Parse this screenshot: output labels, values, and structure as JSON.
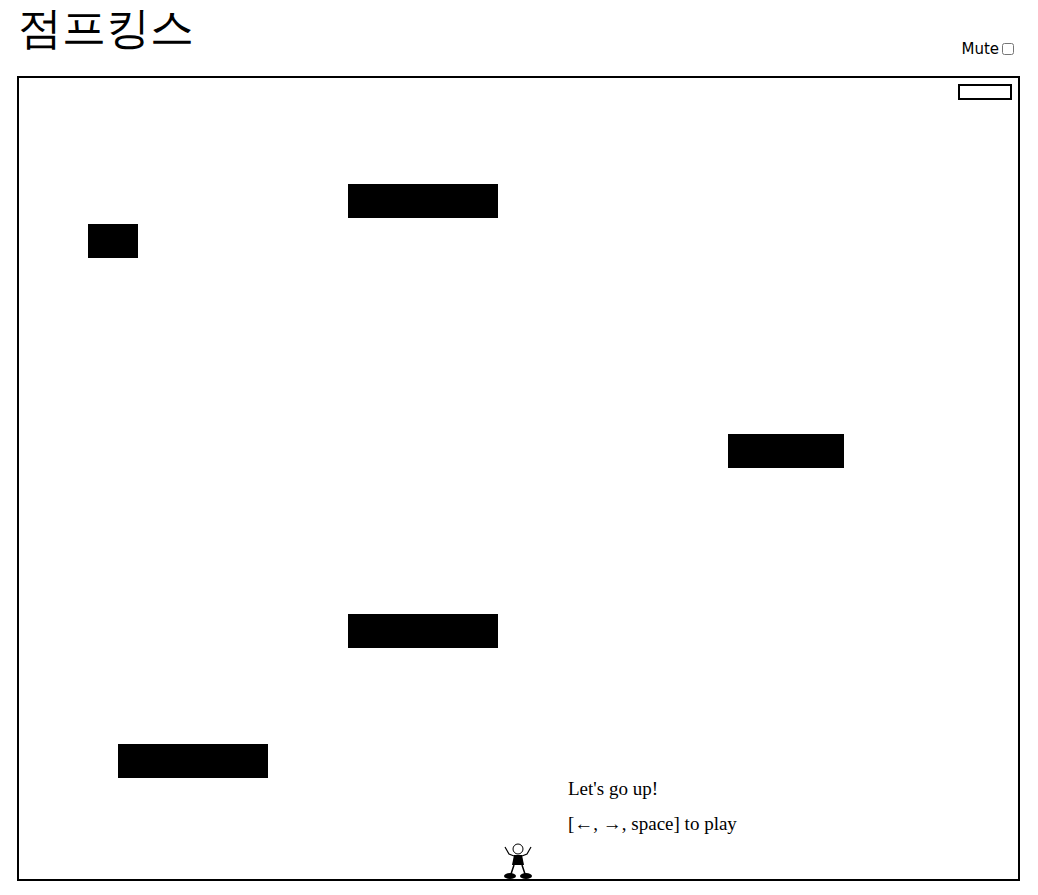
{
  "title": "점프킹스",
  "mute": {
    "label": "Mute",
    "checked": false
  },
  "power": {
    "level": 0
  },
  "hints": [
    "Let's go up!",
    "[←, →, space] to play"
  ]
}
